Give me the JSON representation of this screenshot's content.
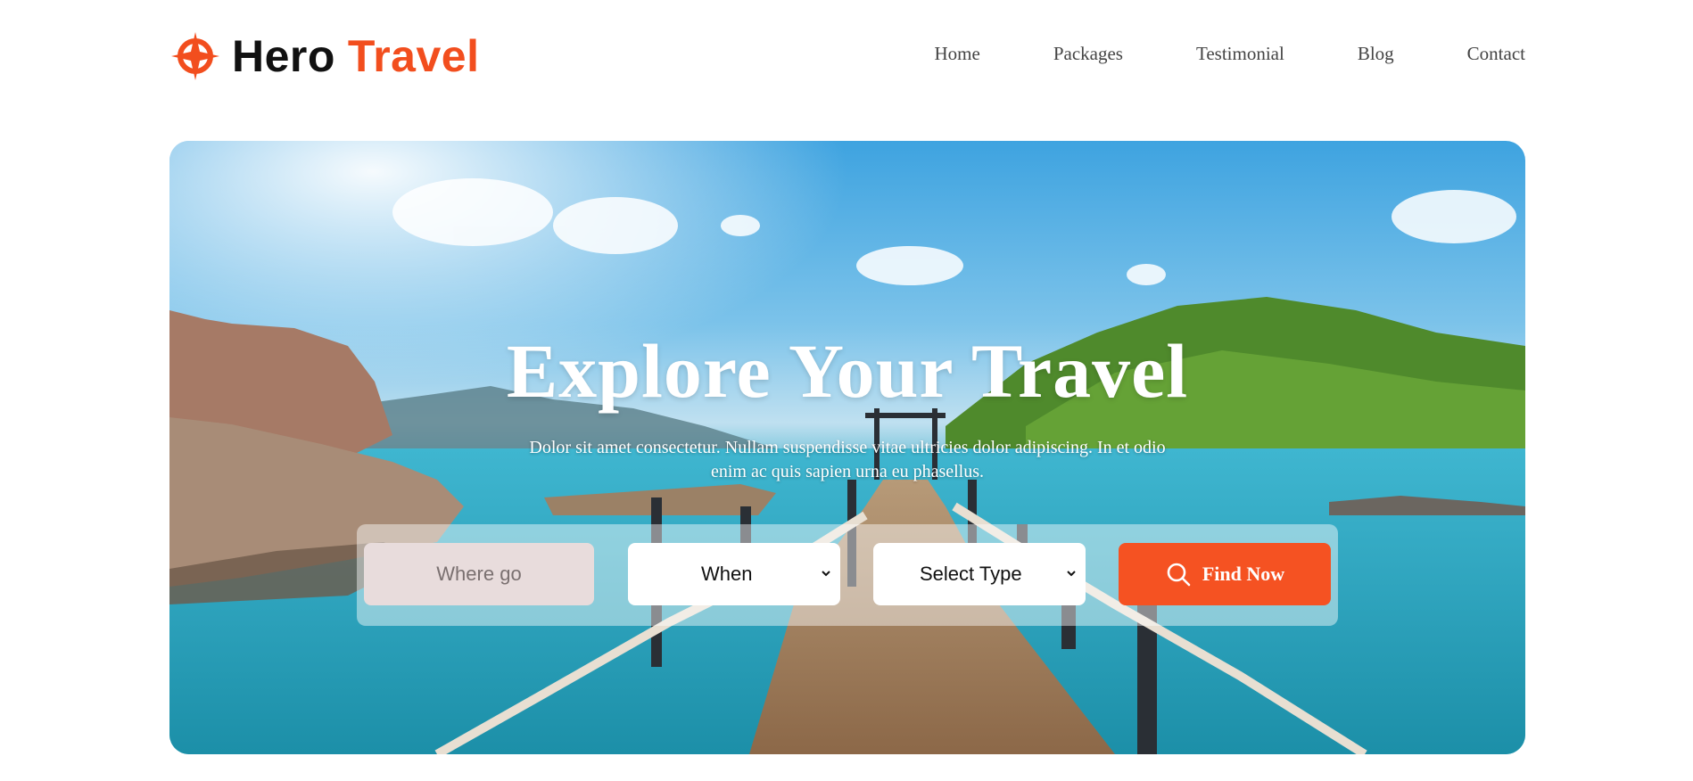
{
  "brand": {
    "word1": "Hero",
    "word2": "Travel",
    "accent": "#f24e1e",
    "icon": "compass-icon"
  },
  "nav": [
    "Home",
    "Packages",
    "Testimonial",
    "Blog",
    "Contact"
  ],
  "hero": {
    "title": "Explore Your Travel",
    "subtitle_line1": "Dolor sit amet consectetur. Nullam suspendisse vitae ultricies dolor adipiscing. In et odio",
    "subtitle_line2": "enim ac quis sapien urna eu phasellus."
  },
  "search": {
    "where_placeholder": "Where go",
    "when_value": "When",
    "type_value": "Select Type",
    "button_label": "Find Now",
    "button_icon": "search-icon",
    "button_color": "#f55222"
  }
}
